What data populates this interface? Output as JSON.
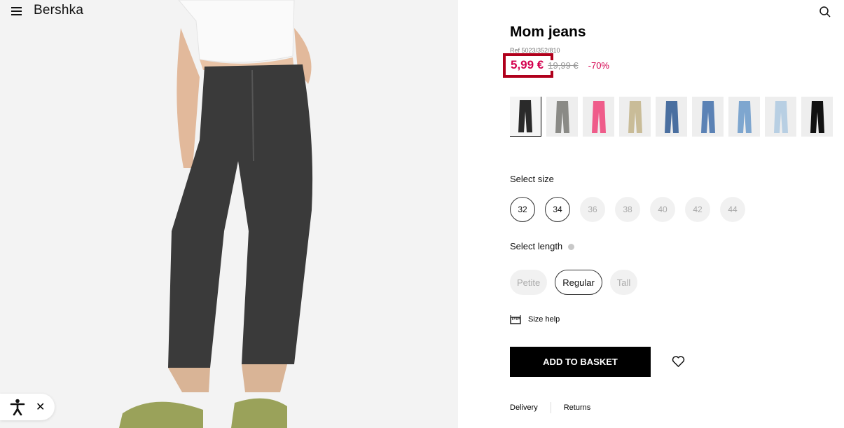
{
  "header": {
    "brand": "Bershka"
  },
  "product": {
    "title": "Mom jeans",
    "ref": "Ref 5023/352/810",
    "price": "5,99 €",
    "old_price": "19,99 €",
    "discount": "-70%"
  },
  "swatches": [
    {
      "name": "black-wash",
      "color": "#2a2a2a"
    },
    {
      "name": "grey",
      "color": "#8a8a86"
    },
    {
      "name": "pink",
      "color": "#ef5c8a"
    },
    {
      "name": "beige",
      "color": "#c9bc98"
    },
    {
      "name": "mid-blue",
      "color": "#4a6fa0"
    },
    {
      "name": "blue",
      "color": "#5b82b5"
    },
    {
      "name": "light-blue",
      "color": "#7ea6cf"
    },
    {
      "name": "ice-blue",
      "color": "#b8cfe3"
    },
    {
      "name": "black",
      "color": "#111111"
    }
  ],
  "size_section": {
    "label": "Select size",
    "sizes": [
      {
        "label": "32",
        "available": true
      },
      {
        "label": "34",
        "available": true
      },
      {
        "label": "36",
        "available": false
      },
      {
        "label": "38",
        "available": false
      },
      {
        "label": "40",
        "available": false
      },
      {
        "label": "42",
        "available": false
      },
      {
        "label": "44",
        "available": false
      }
    ]
  },
  "length_section": {
    "label": "Select length",
    "lengths": [
      {
        "label": "Petite",
        "available": false
      },
      {
        "label": "Regular",
        "available": true
      },
      {
        "label": "Tall",
        "available": false
      }
    ]
  },
  "size_help": "Size help",
  "add_to_basket": "ADD TO BASKET",
  "footer": {
    "delivery": "Delivery",
    "returns": "Returns"
  },
  "colors": {
    "price": "#d4004e",
    "highlight_border": "#b0001c",
    "button": "#000000"
  }
}
